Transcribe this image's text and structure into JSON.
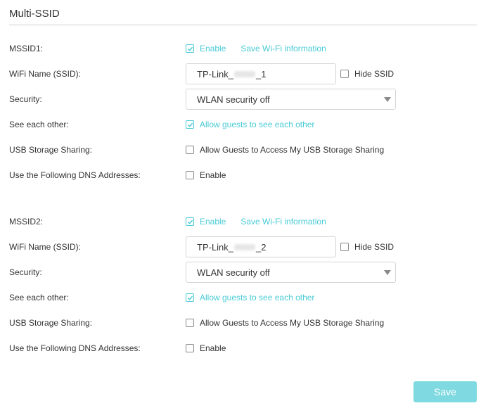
{
  "page": {
    "title": "Multi-SSID"
  },
  "colors": {
    "accent": "#4acbd6",
    "save_button": "#7fd9e0"
  },
  "mssid1": {
    "label": "MSSID1:",
    "enable_label": "Enable",
    "enable_checked": true,
    "save_wifi_link": "Save Wi-Fi information",
    "wifi_name_label": "WiFi Name (SSID):",
    "ssid_prefix": "TP-Link_",
    "ssid_suffix": "_1",
    "hide_ssid_label": "Hide SSID",
    "hide_ssid_checked": false,
    "security_label": "Security:",
    "security_value": "WLAN security off",
    "see_each_other_label": "See each other:",
    "see_each_other_option": "Allow guests to see each other",
    "see_each_other_checked": true,
    "usb_label": "USB Storage Sharing:",
    "usb_option": "Allow Guests to Access My USB Storage Sharing",
    "usb_checked": false,
    "dns_label": "Use the Following DNS Addresses:",
    "dns_option": "Enable",
    "dns_checked": false
  },
  "mssid2": {
    "label": "MSSID2:",
    "enable_label": "Enable",
    "enable_checked": true,
    "save_wifi_link": "Save Wi-Fi information",
    "wifi_name_label": "WiFi Name (SSID):",
    "ssid_prefix": "TP-Link_",
    "ssid_suffix": "_2",
    "hide_ssid_label": "Hide SSID",
    "hide_ssid_checked": false,
    "security_label": "Security:",
    "security_value": "WLAN security off",
    "see_each_other_label": "See each other:",
    "see_each_other_option": "Allow guests to see each other",
    "see_each_other_checked": true,
    "usb_label": "USB Storage Sharing:",
    "usb_option": "Allow Guests to Access My USB Storage Sharing",
    "usb_checked": false,
    "dns_label": "Use the Following DNS Addresses:",
    "dns_option": "Enable",
    "dns_checked": false
  },
  "footer": {
    "save_label": "Save"
  }
}
